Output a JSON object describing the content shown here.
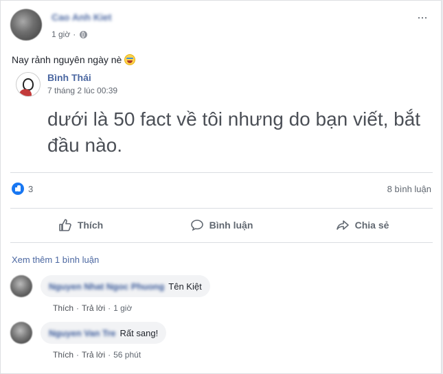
{
  "post": {
    "author": "Cao Anh Kiet",
    "time": "1 giờ",
    "more_icon": "···",
    "text": "Nay rảnh nguyên ngày nè",
    "emoji": "laughing-emoji"
  },
  "shared": {
    "author": "Bình Thái",
    "time": "7 tháng 2 lúc 00:39",
    "body": "dưới là 50 fact về tôi nhưng do bạn viết, bắt đầu nào."
  },
  "stats": {
    "likes": "3",
    "comments": "8 bình luận"
  },
  "actions": {
    "like": "Thích",
    "comment": "Bình luận",
    "share": "Chia sẻ"
  },
  "comments": {
    "see_more": "Xem thêm 1 bình luận",
    "items": [
      {
        "author": "Nguyen Nhat Ngoc Phuong",
        "text": "Tên Kiệt",
        "like": "Thích",
        "reply": "Trả lời",
        "time": "1 giờ"
      },
      {
        "author": "Nguyen Van Tre",
        "text": "Rất sang!",
        "like": "Thích",
        "reply": "Trả lời",
        "time": "56 phút"
      }
    ]
  },
  "colors": {
    "link_blue": "#4b67a1",
    "like_blue": "#1877f2",
    "secondary_text": "#606770"
  }
}
